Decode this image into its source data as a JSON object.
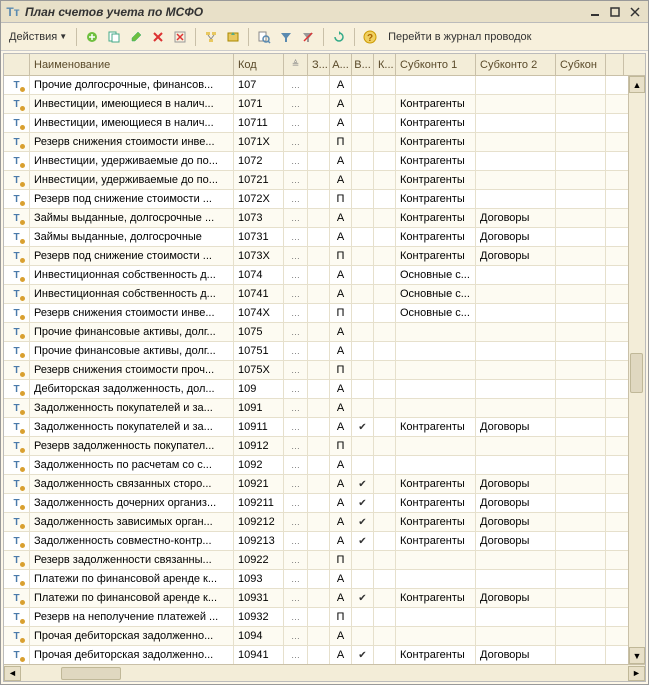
{
  "window": {
    "title": "План счетов учета по МСФО"
  },
  "toolbar": {
    "actions_label": "Действия",
    "journal_link": "Перейти в журнал проводок"
  },
  "columns": {
    "c0": "",
    "name": "Наименование",
    "code": "Код",
    "sort": "",
    "z": "З...",
    "a": "А...",
    "v": "В...",
    "k": "К...",
    "s1": "Субконто 1",
    "s2": "Субконто 2",
    "s3": "Субкон"
  },
  "rows": [
    {
      "name": "Прочие долгосрочные, финансов...",
      "code": "107",
      "a": "А",
      "v": "",
      "s1": "",
      "s2": ""
    },
    {
      "name": "Инвестиции, имеющиеся в налич...",
      "code": "1071",
      "a": "А",
      "v": "",
      "s1": "Контрагенты",
      "s2": ""
    },
    {
      "name": "Инвестиции, имеющиеся в налич...",
      "code": "10711",
      "a": "А",
      "v": "",
      "s1": "Контрагенты",
      "s2": ""
    },
    {
      "name": "Резерв снижения стоимости инве...",
      "code": "1071X",
      "a": "П",
      "v": "",
      "s1": "Контрагенты",
      "s2": ""
    },
    {
      "name": "Инвестиции, удерживаемые до по...",
      "code": "1072",
      "a": "А",
      "v": "",
      "s1": "Контрагенты",
      "s2": ""
    },
    {
      "name": "Инвестиции, удерживаемые до по...",
      "code": "10721",
      "a": "А",
      "v": "",
      "s1": "Контрагенты",
      "s2": ""
    },
    {
      "name": "Резерв под снижение стоимости ...",
      "code": "1072X",
      "a": "П",
      "v": "",
      "s1": "Контрагенты",
      "s2": ""
    },
    {
      "name": "Займы выданные, долгосрочные ...",
      "code": "1073",
      "a": "А",
      "v": "",
      "s1": "Контрагенты",
      "s2": "Договоры"
    },
    {
      "name": "Займы выданные, долгосрочные",
      "code": "10731",
      "a": "А",
      "v": "",
      "s1": "Контрагенты",
      "s2": "Договоры"
    },
    {
      "name": "Резерв под снижение стоимости ...",
      "code": "1073X",
      "a": "П",
      "v": "",
      "s1": "Контрагенты",
      "s2": "Договоры"
    },
    {
      "name": "Инвестиционная собственность д...",
      "code": "1074",
      "a": "А",
      "v": "",
      "s1": "Основные с...",
      "s2": ""
    },
    {
      "name": "Инвестиционная собственность д...",
      "code": "10741",
      "a": "А",
      "v": "",
      "s1": "Основные с...",
      "s2": ""
    },
    {
      "name": "Резерв снижения стоимости инве...",
      "code": "1074X",
      "a": "П",
      "v": "",
      "s1": "Основные с...",
      "s2": ""
    },
    {
      "name": "Прочие финансовые активы, долг...",
      "code": "1075",
      "a": "А",
      "v": "",
      "s1": "",
      "s2": ""
    },
    {
      "name": "Прочие финансовые активы, долг...",
      "code": "10751",
      "a": "А",
      "v": "",
      "s1": "",
      "s2": ""
    },
    {
      "name": "Резерв снижения стоимости проч...",
      "code": "1075X",
      "a": "П",
      "v": "",
      "s1": "",
      "s2": ""
    },
    {
      "name": "Дебиторская задолженность, дол...",
      "code": "109",
      "a": "А",
      "v": "",
      "s1": "",
      "s2": ""
    },
    {
      "name": "Задолженность покупателей и за...",
      "code": "1091",
      "a": "А",
      "v": "",
      "s1": "",
      "s2": ""
    },
    {
      "name": "Задолженность покупателей и за...",
      "code": "10911",
      "a": "А",
      "v": "✓",
      "s1": "Контрагенты",
      "s2": "Договоры"
    },
    {
      "name": "Резерв задолженность покупател...",
      "code": "10912",
      "a": "П",
      "v": "",
      "s1": "",
      "s2": ""
    },
    {
      "name": "Задолженность по расчетам со с...",
      "code": "1092",
      "a": "А",
      "v": "",
      "s1": "",
      "s2": ""
    },
    {
      "name": "Задолженность связанных сторо...",
      "code": "10921",
      "a": "А",
      "v": "✓",
      "s1": "Контрагенты",
      "s2": "Договоры"
    },
    {
      "name": "Задолженность дочерних организ...",
      "code": "109211",
      "a": "А",
      "v": "✓",
      "s1": "Контрагенты",
      "s2": "Договоры"
    },
    {
      "name": "Задолженность зависимых орган...",
      "code": "109212",
      "a": "А",
      "v": "✓",
      "s1": "Контрагенты",
      "s2": "Договоры"
    },
    {
      "name": "Задолженность совместно-контр...",
      "code": "109213",
      "a": "А",
      "v": "✓",
      "s1": "Контрагенты",
      "s2": "Договоры"
    },
    {
      "name": "Резерв задолженности связанны...",
      "code": "10922",
      "a": "П",
      "v": "",
      "s1": "",
      "s2": ""
    },
    {
      "name": "Платежи по финансовой аренде к...",
      "code": "1093",
      "a": "А",
      "v": "",
      "s1": "",
      "s2": ""
    },
    {
      "name": "Платежи по финансовой аренде к...",
      "code": "10931",
      "a": "А",
      "v": "✓",
      "s1": "Контрагенты",
      "s2": "Договоры"
    },
    {
      "name": "Резерв на неполучение платежей ...",
      "code": "10932",
      "a": "П",
      "v": "",
      "s1": "",
      "s2": ""
    },
    {
      "name": "Прочая дебиторская задолженно...",
      "code": "1094",
      "a": "А",
      "v": "",
      "s1": "",
      "s2": ""
    },
    {
      "name": "Прочая дебиторская задолженно...",
      "code": "10941",
      "a": "А",
      "v": "✓",
      "s1": "Контрагенты",
      "s2": "Договоры"
    }
  ]
}
